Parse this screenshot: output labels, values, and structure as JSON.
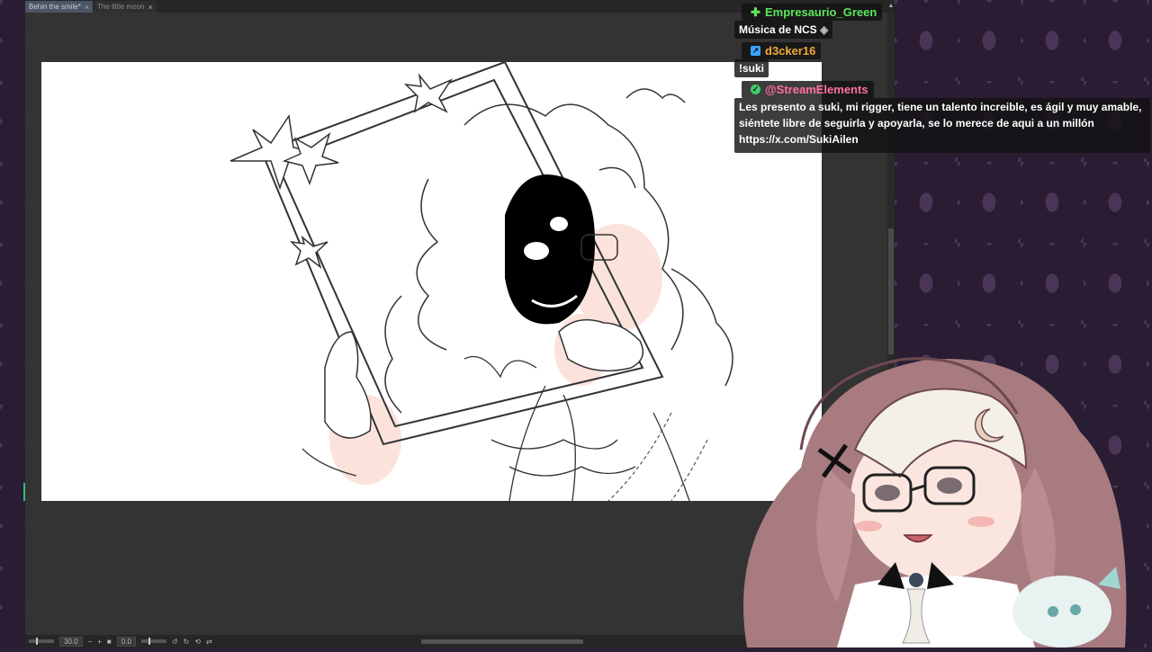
{
  "tabs": [
    {
      "label": "Behin the smile*",
      "active": true
    },
    {
      "label": "The little moon",
      "active": false
    }
  ],
  "status": {
    "zoom": "30.0",
    "rotation": "0.0"
  },
  "chat": {
    "messages": [
      {
        "user": "Empresaurio_Green",
        "color": "#5ee85a",
        "badge_color": "#5ee85a",
        "badge_icon": "plus-badge-icon",
        "text": "Música de NCS"
      },
      {
        "user": "d3cker16",
        "color": "#f2a93b",
        "badge_color": "#3aa7ff",
        "badge_icon": "prime-badge-icon",
        "text": "!suki"
      },
      {
        "user": "@StreamElements",
        "color": "#ff6fa5",
        "badge_color": "#3ccf6b",
        "badge_icon": "verified-badge-icon",
        "text": "Les presento a suki, mi rigger, tiene un talento increible, es ágil y muy amable, siéntete libre de seguirla y apoyarla, se lo merece de aqui a un millón https://x.com/SukiAilen"
      }
    ]
  },
  "colors": {
    "app_bg": "#333333",
    "wallpaper": "#2a1c33",
    "accent_tab": "#4b5566"
  }
}
